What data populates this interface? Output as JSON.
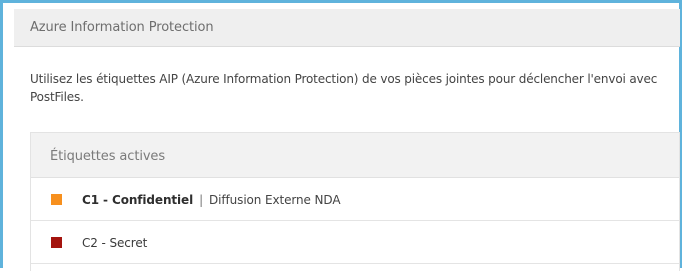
{
  "panel": {
    "title": "Azure Information Protection",
    "description": "Utilisez les étiquettes AIP (Azure Information Protection) de vos pièces jointes pour déclencher l'envoi avec PostFiles."
  },
  "labels_section": {
    "title": "Étiquettes actives",
    "items": [
      {
        "name": "C1 - Confidentiel",
        "separator": "|",
        "detail": "Diffusion Externe NDA",
        "color": "#f7901e",
        "bold": true
      },
      {
        "name": "C2 - Secret",
        "detail": "",
        "color": "#a4140e",
        "bold": false
      }
    ]
  }
}
